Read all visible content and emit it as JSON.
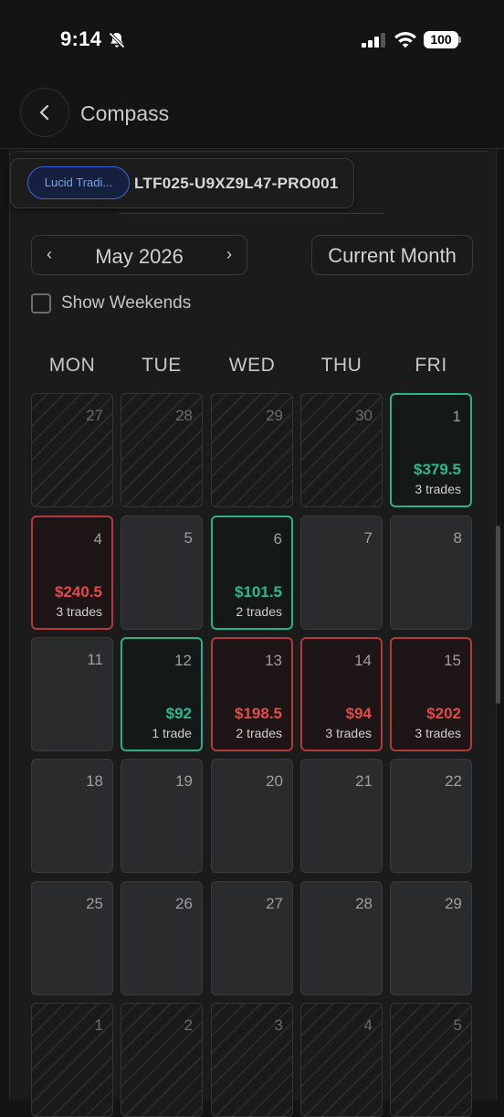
{
  "status_bar": {
    "time": "9:14",
    "battery": "100",
    "icons": [
      "bell-slash-icon",
      "signal-icon",
      "wifi-icon",
      "battery-icon"
    ]
  },
  "header": {
    "title": "Compass",
    "back_icon": "chevron-left-icon"
  },
  "account": {
    "chip_label": "Lucid Tradi...",
    "account_id": "LTF025-U9XZ9L47-PRO001"
  },
  "calendar": {
    "prev_label": "‹",
    "next_label": "›",
    "month_label": "May 2026",
    "current_month_label": "Current Month",
    "show_weekends_label": "Show Weekends",
    "show_weekends_checked": false,
    "weekdays": [
      "MON",
      "TUE",
      "WED",
      "THU",
      "FRI"
    ],
    "colors": {
      "profit": "#2eb88f",
      "loss": "#e24b4b"
    },
    "weeks": [
      [
        {
          "day": "27",
          "state": "outside"
        },
        {
          "day": "28",
          "state": "outside"
        },
        {
          "day": "29",
          "state": "outside"
        },
        {
          "day": "30",
          "state": "outside"
        },
        {
          "day": "1",
          "state": "profit",
          "pnl": "$379.5",
          "trades": "3 trades"
        }
      ],
      [
        {
          "day": "4",
          "state": "loss",
          "pnl": "$240.5",
          "trades": "3 trades"
        },
        {
          "day": "5",
          "state": "empty"
        },
        {
          "day": "6",
          "state": "profit",
          "pnl": "$101.5",
          "trades": "2 trades"
        },
        {
          "day": "7",
          "state": "empty"
        },
        {
          "day": "8",
          "state": "empty"
        }
      ],
      [
        {
          "day": "11",
          "state": "empty"
        },
        {
          "day": "12",
          "state": "profit",
          "pnl": "$92",
          "trades": "1 trade"
        },
        {
          "day": "13",
          "state": "loss",
          "pnl": "$198.5",
          "trades": "2 trades"
        },
        {
          "day": "14",
          "state": "loss",
          "pnl": "$94",
          "trades": "3 trades"
        },
        {
          "day": "15",
          "state": "loss",
          "pnl": "$202",
          "trades": "3 trades"
        }
      ],
      [
        {
          "day": "18",
          "state": "empty"
        },
        {
          "day": "19",
          "state": "empty"
        },
        {
          "day": "20",
          "state": "empty"
        },
        {
          "day": "21",
          "state": "empty"
        },
        {
          "day": "22",
          "state": "empty"
        }
      ],
      [
        {
          "day": "25",
          "state": "empty"
        },
        {
          "day": "26",
          "state": "empty"
        },
        {
          "day": "27",
          "state": "empty"
        },
        {
          "day": "28",
          "state": "empty"
        },
        {
          "day": "29",
          "state": "empty"
        }
      ],
      [
        {
          "day": "1",
          "state": "outside"
        },
        {
          "day": "2",
          "state": "outside"
        },
        {
          "day": "3",
          "state": "outside"
        },
        {
          "day": "4",
          "state": "outside"
        },
        {
          "day": "5",
          "state": "outside"
        }
      ]
    ]
  }
}
